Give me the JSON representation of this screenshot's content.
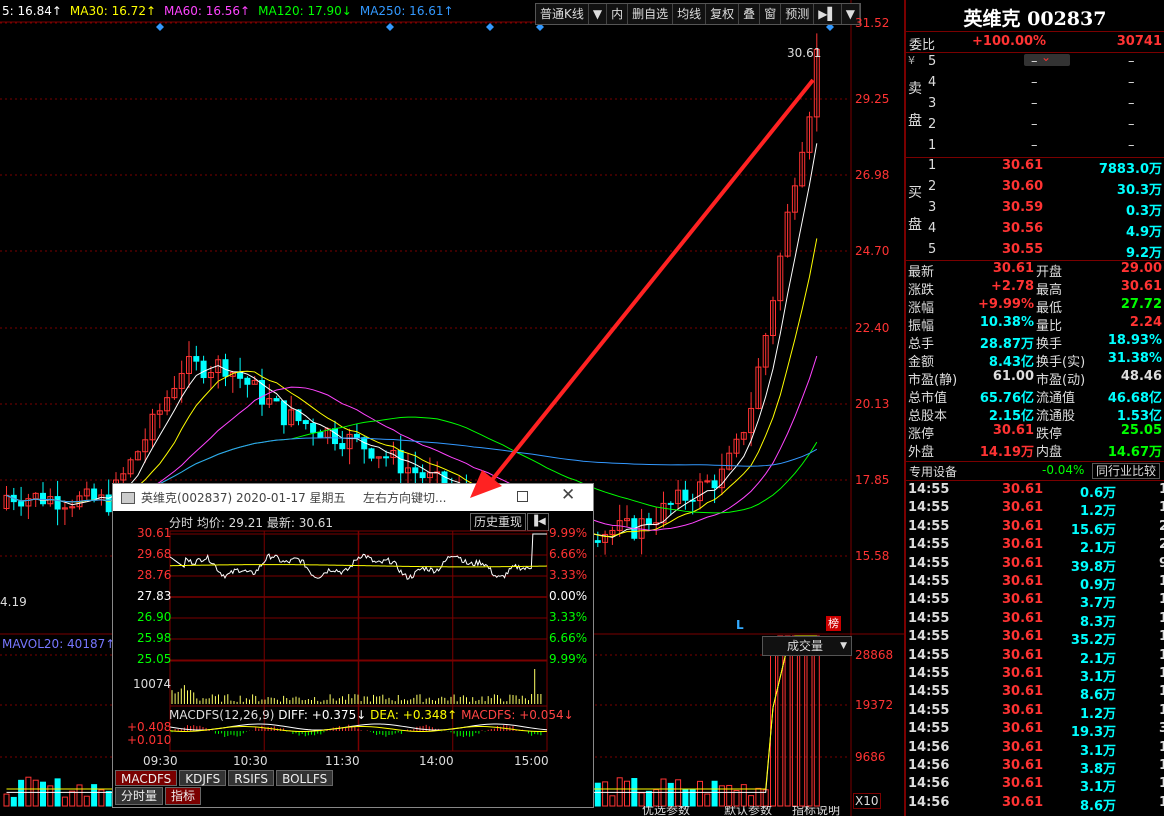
{
  "ma_legend": [
    {
      "label": "5: 16.84↑",
      "color": "#ffffff"
    },
    {
      "label": "MA30: 16.72↑",
      "color": "#ffff00"
    },
    {
      "label": "MA60: 16.56↑",
      "color": "#ff44ff"
    },
    {
      "label": "MA120: 17.90↓",
      "color": "#00ff00"
    },
    {
      "label": "MA250: 16.61↑",
      "color": "#3399ff"
    }
  ],
  "toolbar": {
    "items": [
      "普通K线",
      "▼",
      "内",
      "删自选",
      "均线",
      "复权",
      "叠",
      "窗",
      "预测",
      "▶▌",
      "▼"
    ]
  },
  "price_axis": [
    "31.52",
    "29.25",
    "26.98",
    "24.70",
    "22.40",
    "20.13",
    "17.85",
    "15.58"
  ],
  "chart_annotations": {
    "last_price": "30.61",
    "low_label": "4.19",
    "bang": "榜",
    "mark_l": "L",
    "scale": "X10"
  },
  "volume": {
    "legend": "MAVOL20: 40187↑",
    "dropdown": "成交量",
    "axis": [
      "28868",
      "19372",
      "9686"
    ]
  },
  "quote": {
    "title": "英维克 002837",
    "weibi_label": "委比",
    "weibi_pct": "+100.00%",
    "weibi_val": "30741",
    "yen": "¥",
    "sell_label": [
      "卖",
      "盘"
    ],
    "buy_label": [
      "买",
      "盘"
    ],
    "sell": [
      {
        "lvl": "5",
        "price": "–",
        "vol": "–"
      },
      {
        "lvl": "4",
        "price": "–",
        "vol": "–"
      },
      {
        "lvl": "3",
        "price": "–",
        "vol": "–"
      },
      {
        "lvl": "2",
        "price": "–",
        "vol": "–"
      },
      {
        "lvl": "1",
        "price": "–",
        "vol": "–"
      }
    ],
    "buy": [
      {
        "lvl": "1",
        "price": "30.61",
        "vol": "7883.0万"
      },
      {
        "lvl": "2",
        "price": "30.60",
        "vol": "30.3万"
      },
      {
        "lvl": "3",
        "price": "30.59",
        "vol": "0.3万"
      },
      {
        "lvl": "4",
        "price": "30.56",
        "vol": "4.9万"
      },
      {
        "lvl": "5",
        "price": "30.55",
        "vol": "9.2万"
      }
    ],
    "stats": [
      {
        "l1": "最新",
        "v1": "30.61",
        "c1": "#ff3333",
        "l2": "开盘",
        "v2": "29.00",
        "c2": "#ff3333"
      },
      {
        "l1": "涨跌",
        "v1": "+2.78",
        "c1": "#ff3333",
        "l2": "最高",
        "v2": "30.61",
        "c2": "#ff3333"
      },
      {
        "l1": "涨幅",
        "v1": "+9.99%",
        "c1": "#ff3333",
        "l2": "最低",
        "v2": "27.72",
        "c2": "#00ff00"
      },
      {
        "l1": "振幅",
        "v1": "10.38%",
        "c1": "#00ffff",
        "l2": "量比",
        "v2": "2.24",
        "c2": "#ff3333"
      },
      {
        "l1": "总手",
        "v1": "28.87万",
        "c1": "#00ffff",
        "l2": "换手",
        "v2": "18.93%",
        "c2": "#00ffff"
      },
      {
        "l1": "金额",
        "v1": "8.43亿",
        "c1": "#00ffff",
        "l2": "换手(实)",
        "v2": "31.38%",
        "c2": "#00ffff"
      },
      {
        "l1": "市盈(静)",
        "v1": "61.00",
        "c1": "#dddddd",
        "l2": "市盈(动)",
        "v2": "48.46",
        "c2": "#dddddd"
      },
      {
        "l1": "总市值",
        "v1": "65.76亿",
        "c1": "#00ffff",
        "l2": "流通值",
        "v2": "46.68亿",
        "c2": "#00ffff"
      },
      {
        "l1": "总股本",
        "v1": "2.15亿",
        "c1": "#00ffff",
        "l2": "流通股",
        "v2": "1.53亿",
        "c2": "#00ffff"
      },
      {
        "l1": "涨停",
        "v1": "30.61",
        "c1": "#ff3333",
        "l2": "跌停",
        "v2": "25.05",
        "c2": "#00ff00"
      },
      {
        "l1": "外盘",
        "v1": "14.19万",
        "c1": "#ff3333",
        "l2": "内盘",
        "v2": "14.67万",
        "c2": "#00ff00"
      }
    ],
    "sector": {
      "label": "专用设备",
      "pct": "-0.04%",
      "btn": "同行业比较"
    },
    "ticks": [
      {
        "t": "14:55",
        "p": "30.61",
        "v": "0.6万",
        "n": "1"
      },
      {
        "t": "14:55",
        "p": "30.61",
        "v": "1.2万",
        "n": "1"
      },
      {
        "t": "14:55",
        "p": "30.61",
        "v": "15.6万",
        "n": "2"
      },
      {
        "t": "14:55",
        "p": "30.61",
        "v": "2.1万",
        "n": "2"
      },
      {
        "t": "14:55",
        "p": "30.61",
        "v": "39.8万",
        "n": "9"
      },
      {
        "t": "14:55",
        "p": "30.61",
        "v": "0.9万",
        "n": "1"
      },
      {
        "t": "14:55",
        "p": "30.61",
        "v": "3.7万",
        "n": "1"
      },
      {
        "t": "14:55",
        "p": "30.61",
        "v": "8.3万",
        "n": "1"
      },
      {
        "t": "14:55",
        "p": "30.61",
        "v": "35.2万",
        "n": "1"
      },
      {
        "t": "14:55",
        "p": "30.61",
        "v": "2.1万",
        "n": "1"
      },
      {
        "t": "14:55",
        "p": "30.61",
        "v": "3.1万",
        "n": "1"
      },
      {
        "t": "14:55",
        "p": "30.61",
        "v": "8.6万",
        "n": "1"
      },
      {
        "t": "14:55",
        "p": "30.61",
        "v": "1.2万",
        "n": "1"
      },
      {
        "t": "14:55",
        "p": "30.61",
        "v": "19.3万",
        "n": "3"
      },
      {
        "t": "14:56",
        "p": "30.61",
        "v": "3.1万",
        "n": "1"
      },
      {
        "t": "14:56",
        "p": "30.61",
        "v": "3.8万",
        "n": "1"
      },
      {
        "t": "14:56",
        "p": "30.61",
        "v": "3.1万",
        "n": "1"
      },
      {
        "t": "14:56",
        "p": "30.61",
        "v": "8.6万",
        "n": "1"
      }
    ]
  },
  "popup": {
    "title": "英维克(002837) 2020-01-17 星期五",
    "hint": "左右方向键切...",
    "info": "分时 均价: 29.21 最新: 30.61",
    "history_btn": "历史重现",
    "left_axis": [
      "30.61",
      "29.68",
      "28.76",
      "27.83",
      "26.90",
      "25.98",
      "25.05"
    ],
    "right_axis": [
      "9.99%",
      "6.66%",
      "3.33%",
      "0.00%",
      "3.33%",
      "6.66%",
      "9.99%"
    ],
    "vol_label": "10074",
    "macd": {
      "prefix": "MACDFS(12,26,9)",
      "diff": "DIFF: +0.375↓",
      "dea": "DEA: +0.348↑",
      "macdfs": "MACDFS: +0.054↓",
      "axis": [
        "+0.408",
        "+0.010"
      ]
    },
    "times": [
      "09:30",
      "10:30",
      "11:30",
      "14:00",
      "15:00"
    ],
    "tabs": [
      "MACDFS",
      "KDJFS",
      "RSIFS",
      "BOLLFS"
    ],
    "bottom_tabs": [
      "分时量",
      "指标"
    ]
  },
  "bottom_strip": [
    "优选参数",
    "默认参数",
    "指标说明"
  ],
  "colors": {
    "up": "#ff3333",
    "down": "#00ffff",
    "grid": "#7a0000",
    "bg": "#000000"
  }
}
